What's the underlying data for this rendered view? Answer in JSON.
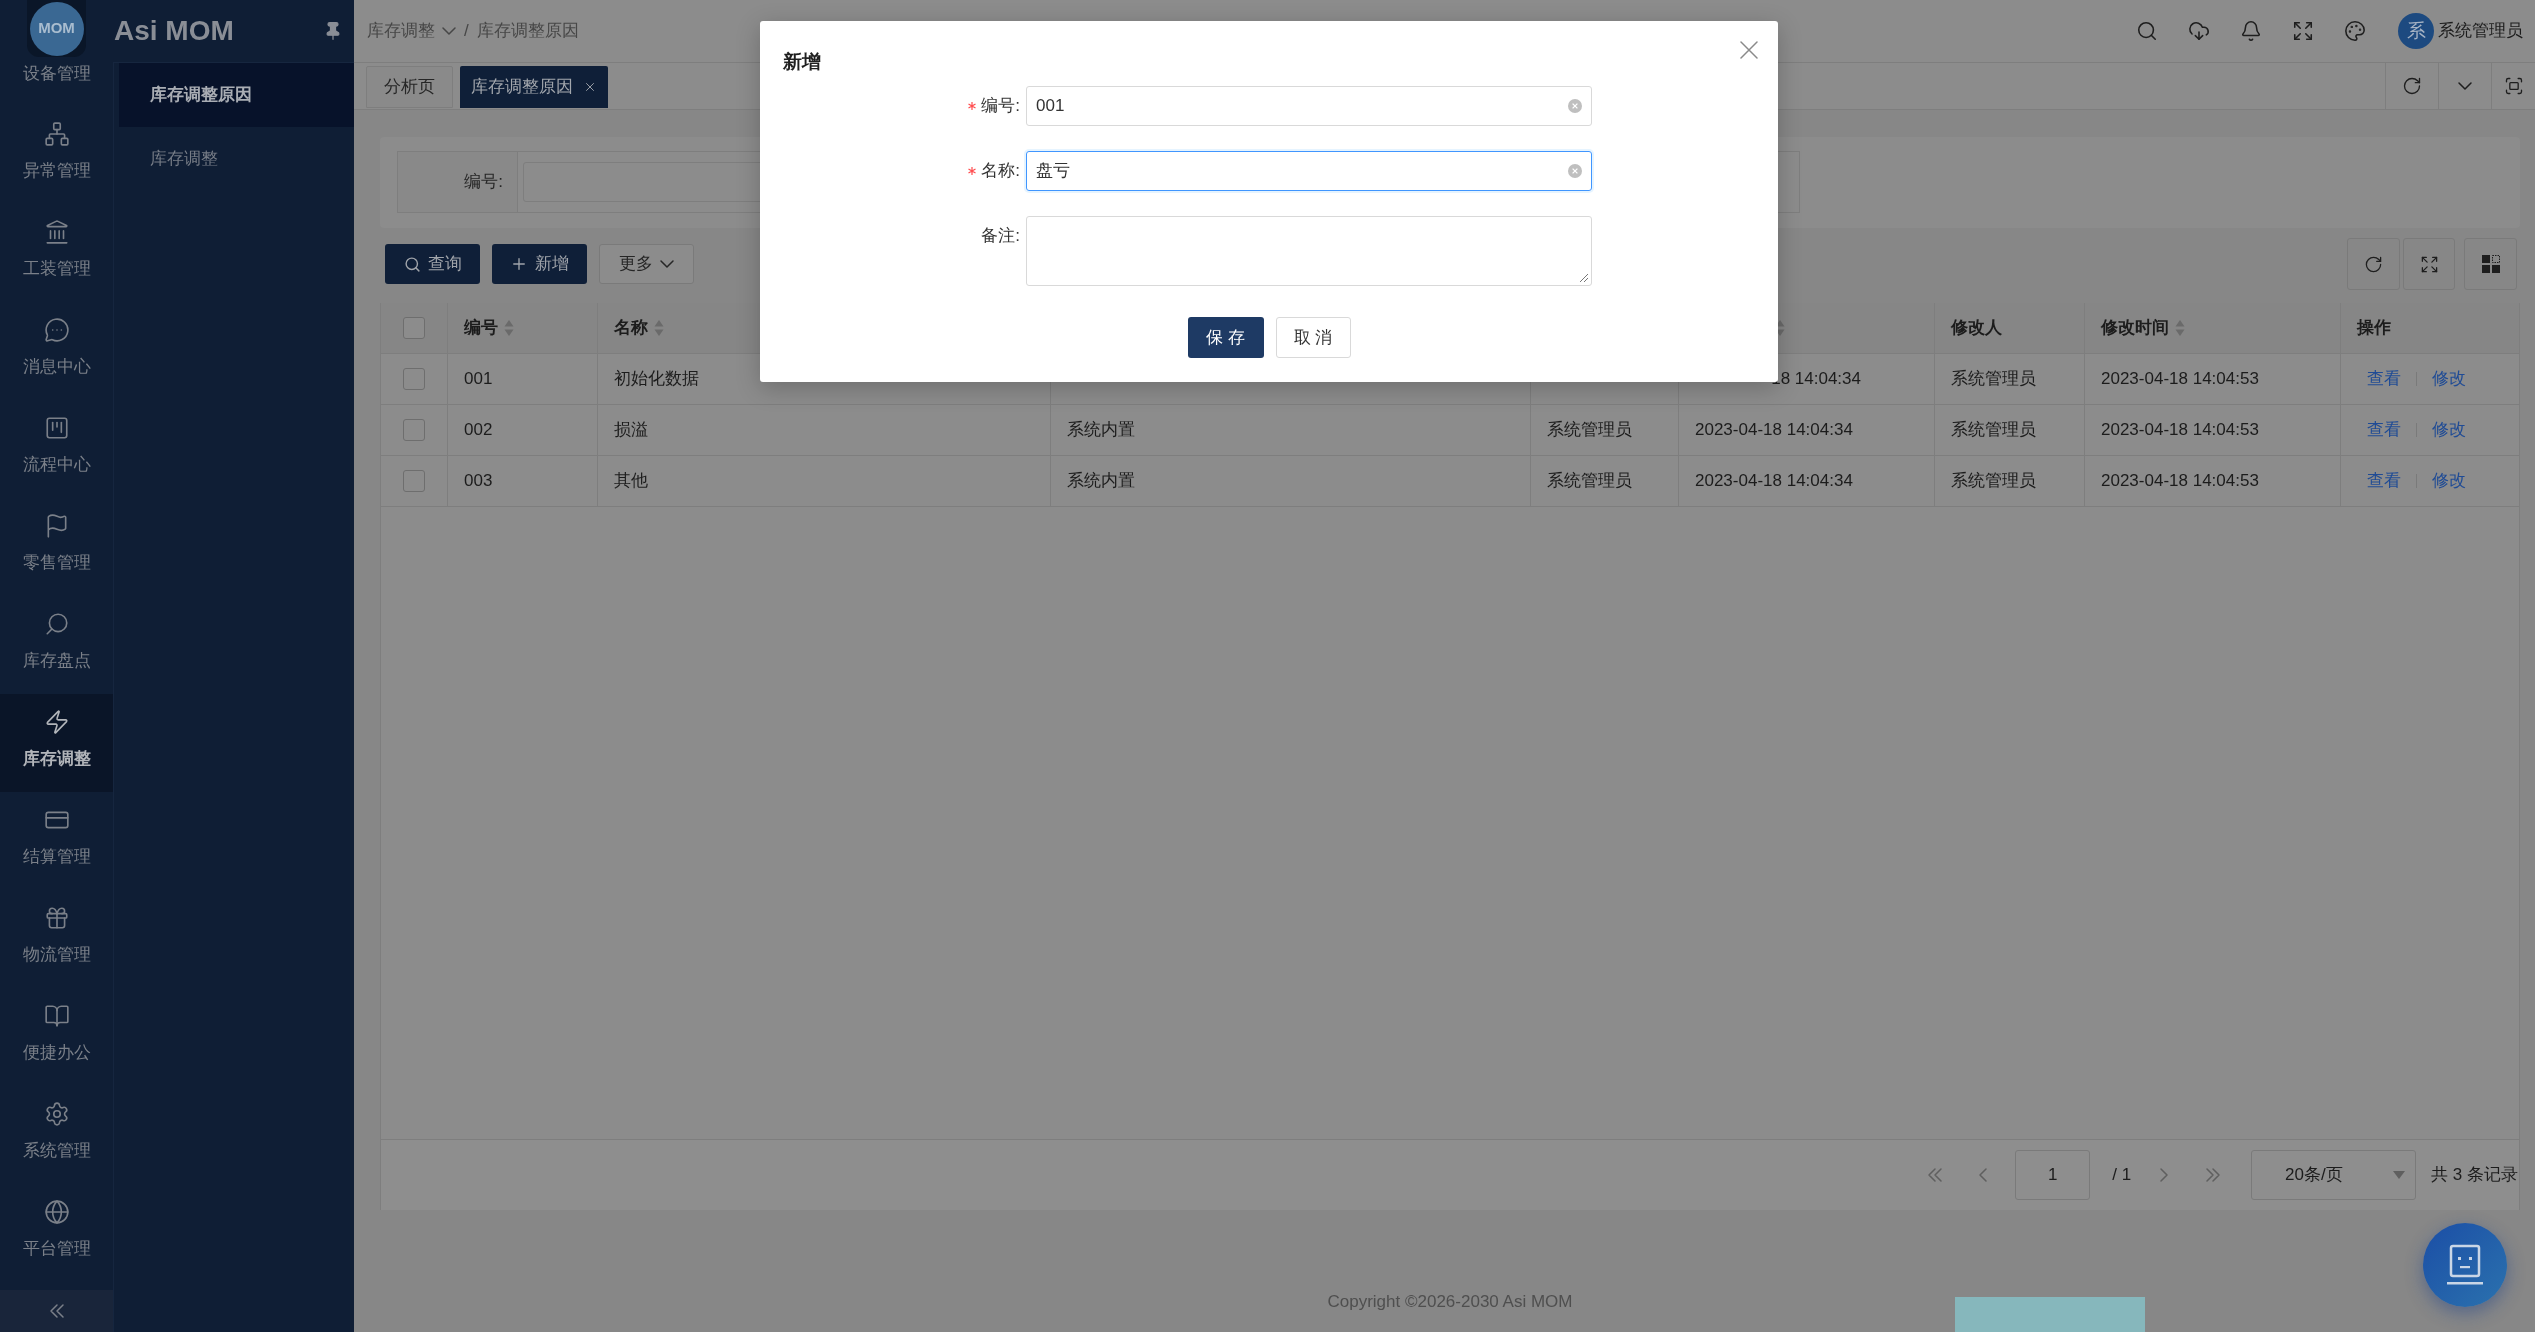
{
  "logo": {
    "text": "MOM"
  },
  "brand": "Asi MOM",
  "nav_rail": {
    "items": [
      {
        "label": "设备管理",
        "selected": false
      },
      {
        "label": "异常管理",
        "selected": false
      },
      {
        "label": "工装管理",
        "selected": false
      },
      {
        "label": "消息中心",
        "selected": false
      },
      {
        "label": "流程中心",
        "selected": false
      },
      {
        "label": "零售管理",
        "selected": false
      },
      {
        "label": "库存盘点",
        "selected": false
      },
      {
        "label": "库存调整",
        "selected": true
      },
      {
        "label": "结算管理",
        "selected": false
      },
      {
        "label": "物流管理",
        "selected": false
      },
      {
        "label": "便捷办公",
        "selected": false
      },
      {
        "label": "系统管理",
        "selected": false
      },
      {
        "label": "平台管理",
        "selected": false
      }
    ]
  },
  "submenu": {
    "items": [
      {
        "label": "库存调整原因",
        "selected": true
      },
      {
        "label": "库存调整",
        "selected": false
      }
    ]
  },
  "header": {
    "breadcrumb": [
      {
        "label": "库存调整",
        "dropdown": true
      },
      {
        "label": "库存调整原因",
        "dropdown": false
      }
    ],
    "breadcrumb_separator": "/",
    "user": {
      "avatar": "系",
      "name": "系统管理员"
    }
  },
  "tabs": [
    {
      "label": "分析页",
      "selected": false,
      "closable": false
    },
    {
      "label": "库存调整原因",
      "selected": true,
      "closable": true
    }
  ],
  "search_form": {
    "fields": [
      {
        "label": "编号:"
      }
    ]
  },
  "toolbar": {
    "buttons": [
      {
        "label": "查询",
        "kind": "search"
      },
      {
        "label": "新增",
        "kind": "add"
      },
      {
        "label": "更多",
        "kind": "more"
      }
    ]
  },
  "table": {
    "header_checked": false,
    "columns": [
      {
        "label": "编号",
        "sortable": true
      },
      {
        "label": "名称",
        "sortable": true
      },
      null,
      null,
      {
        "sortable": true
      },
      {
        "label": "修改人",
        "sortable": false
      },
      {
        "label": "修改时间",
        "sortable": true
      },
      {
        "label": "操作",
        "sortable": false
      }
    ],
    "rows": [
      {
        "checked": false,
        "cells": [
          "001",
          "初始化数据",
          null,
          null,
          {
            "text": "18 14:04:34",
            "clipped": true
          },
          "系统管理员",
          "2023-04-18 14:04:53"
        ],
        "actions": [
          "查看",
          "修改"
        ]
      },
      {
        "checked": false,
        "cells": [
          "002",
          "损溢",
          "系统内置",
          "系统管理员",
          "2023-04-18 14:04:34",
          "系统管理员",
          "2023-04-18 14:04:53"
        ],
        "actions": [
          "查看",
          "修改"
        ]
      },
      {
        "checked": false,
        "cells": [
          "003",
          "其他",
          "系统内置",
          "系统管理员",
          "2023-04-18 14:04:34",
          "系统管理员",
          "2023-04-18 14:04:53"
        ],
        "actions": [
          "查看",
          "修改"
        ]
      }
    ]
  },
  "pagination": {
    "page": "1",
    "pages": "/ 1",
    "page_size": "20条/页",
    "total": "共 3 条记录"
  },
  "footer": {
    "copyright": "Copyright ©2026-2030 Asi MOM"
  },
  "dialog": {
    "title": "新增",
    "fields": [
      {
        "label": "编号:",
        "required": true,
        "kind": "input",
        "value": "001",
        "focused": false
      },
      {
        "label": "名称:",
        "required": true,
        "kind": "input",
        "value": "盘亏",
        "focused": true
      },
      {
        "label": "备注:",
        "required": false,
        "kind": "textarea"
      }
    ],
    "buttons": [
      {
        "label": "保 存",
        "kind": "primary"
      },
      {
        "label": "取 消",
        "kind": "default"
      }
    ]
  }
}
